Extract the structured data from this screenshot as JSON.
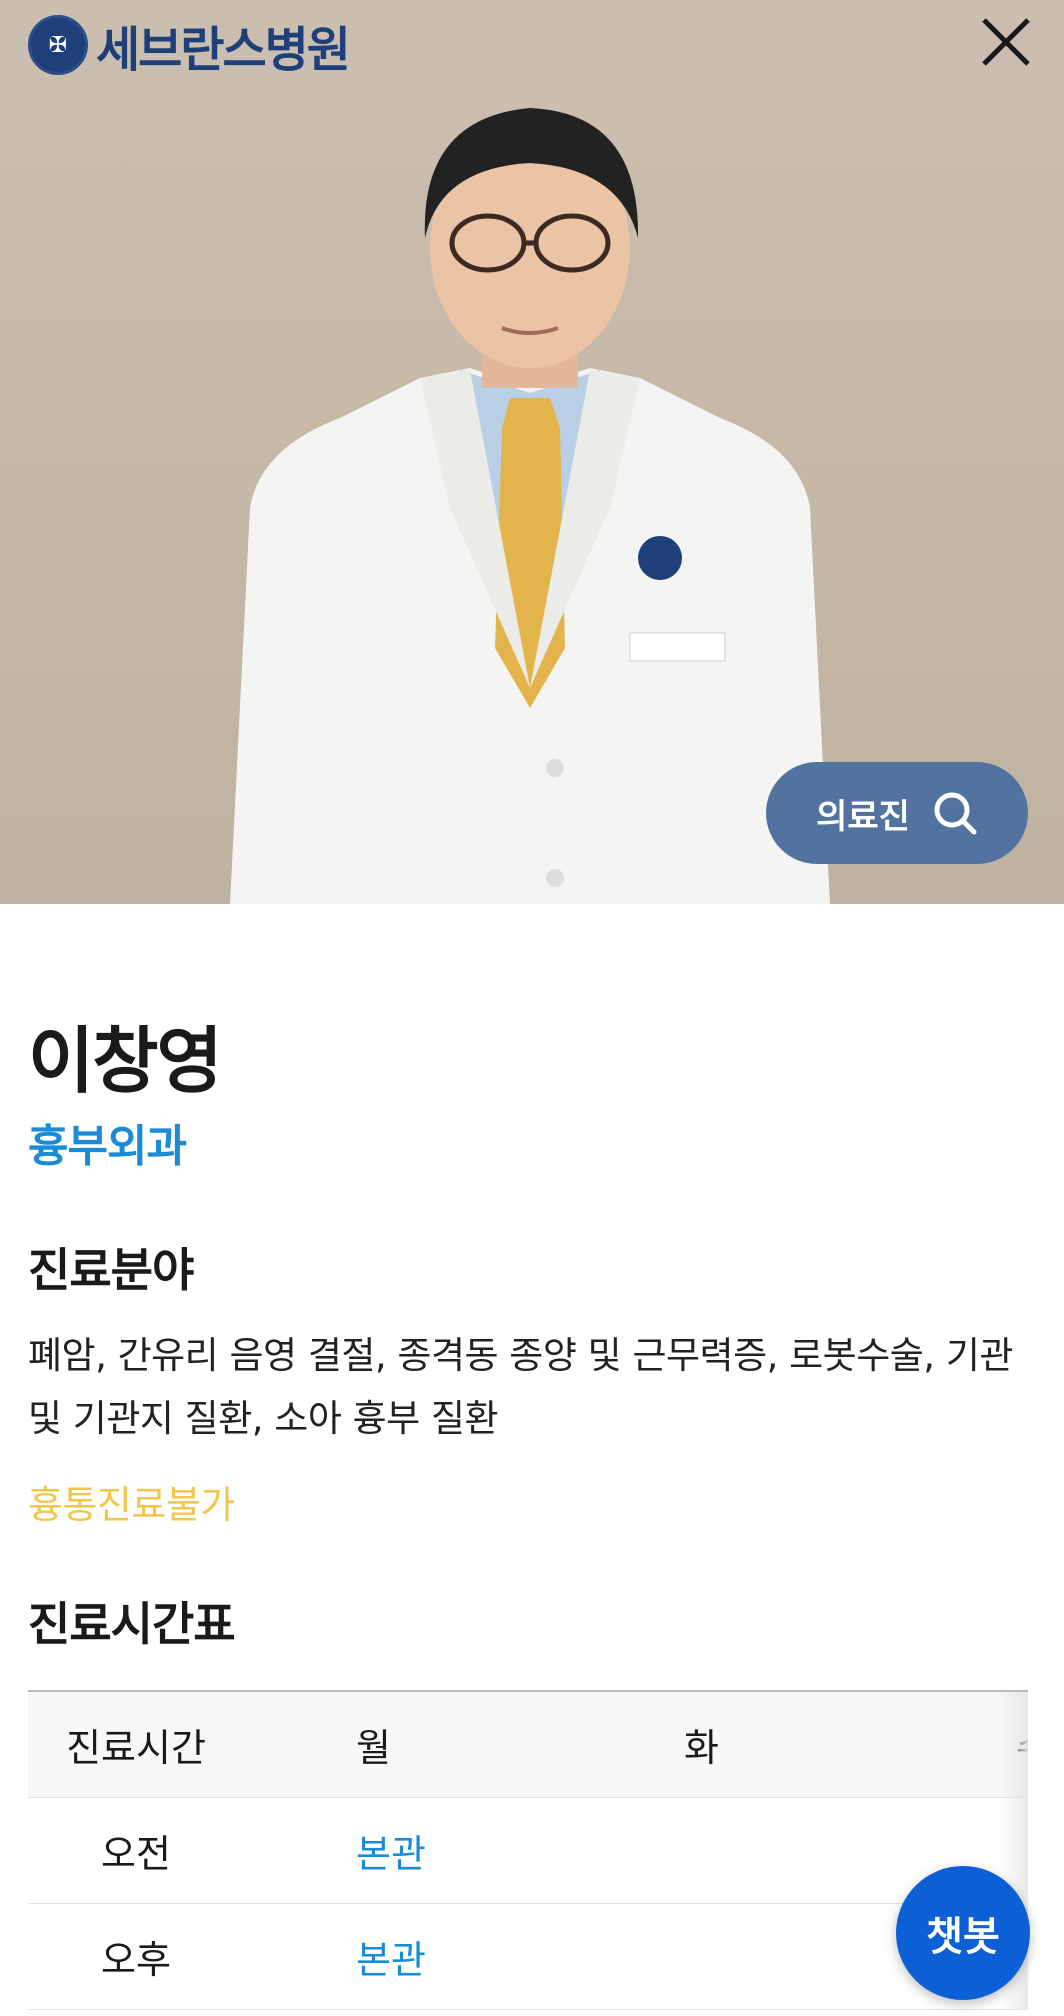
{
  "header": {
    "logo_text": "세브란스병원",
    "logo_icon": "severance-emblem-icon",
    "close_icon": "close-icon"
  },
  "hero": {
    "staff_search_label": "의료진",
    "staff_search_icon": "search-icon"
  },
  "doctor": {
    "name": "이창영",
    "department": "흉부외과"
  },
  "specialty": {
    "title": "진료분야",
    "text": "폐암, 간유리 음영 결절, 종격동 종양 및 근무력증, 로봇수술, 기관 및 기관지 질환, 소아 흉부 질환",
    "notice": "흉통진료불가"
  },
  "schedule": {
    "title": "진료시간표",
    "headers": [
      "진료시간",
      "월",
      "화",
      "수"
    ],
    "rows": [
      {
        "label": "오전",
        "mon": "본관",
        "tue": "",
        "wed": ""
      },
      {
        "label": "오후",
        "mon": "본관",
        "tue": "",
        "wed": ""
      }
    ]
  },
  "chatbot": {
    "label": "챗봇"
  },
  "colors": {
    "brand_navy": "#1f3f79",
    "link_blue": "#1a8bd6",
    "notice_yellow": "#f0c64e",
    "search_button": "#52739f",
    "chatbot_blue": "#0d5fd6"
  }
}
